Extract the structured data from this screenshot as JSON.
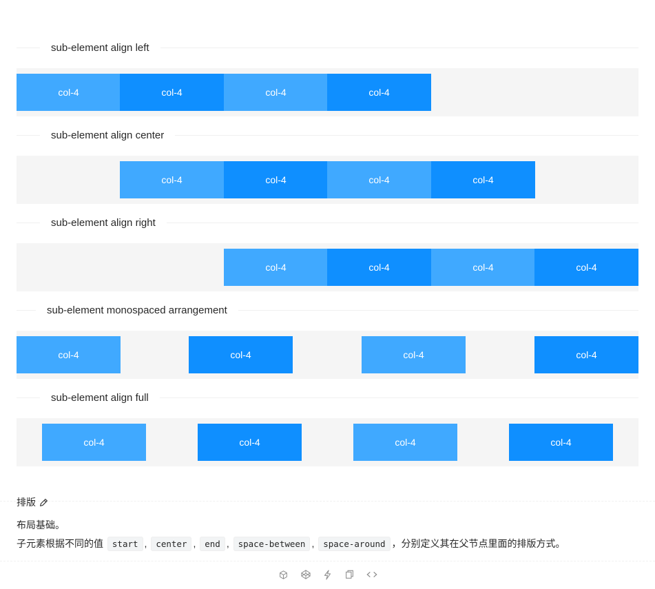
{
  "sections": [
    {
      "title": "sub-element align left",
      "cols": [
        "col-4",
        "col-4",
        "col-4",
        "col-4"
      ]
    },
    {
      "title": "sub-element align center",
      "cols": [
        "col-4",
        "col-4",
        "col-4",
        "col-4"
      ]
    },
    {
      "title": "sub-element align right",
      "cols": [
        "col-4",
        "col-4",
        "col-4",
        "col-4"
      ]
    },
    {
      "title": "sub-element monospaced arrangement",
      "cols": [
        "col-4",
        "col-4",
        "col-4",
        "col-4"
      ]
    },
    {
      "title": "sub-element align full",
      "cols": [
        "col-4",
        "col-4",
        "col-4",
        "col-4"
      ]
    }
  ],
  "doc": {
    "title": "排版",
    "line1": "布局基础。",
    "line2_prefix": "子元素根据不同的值",
    "codes": [
      "start",
      "center",
      "end",
      "space-between",
      "space-around"
    ],
    "sep": ",",
    "line2_suffix": "，分别定义其在父节点里面的排版方式。"
  },
  "colors": {
    "col_light": "#40a9ff",
    "col_dark": "#0f8fff",
    "row_bg": "#f5f5f5"
  },
  "actions": [
    "codesandbox-icon",
    "codepen-icon",
    "thunderbolt-icon",
    "copy-icon",
    "code-expand-icon"
  ]
}
